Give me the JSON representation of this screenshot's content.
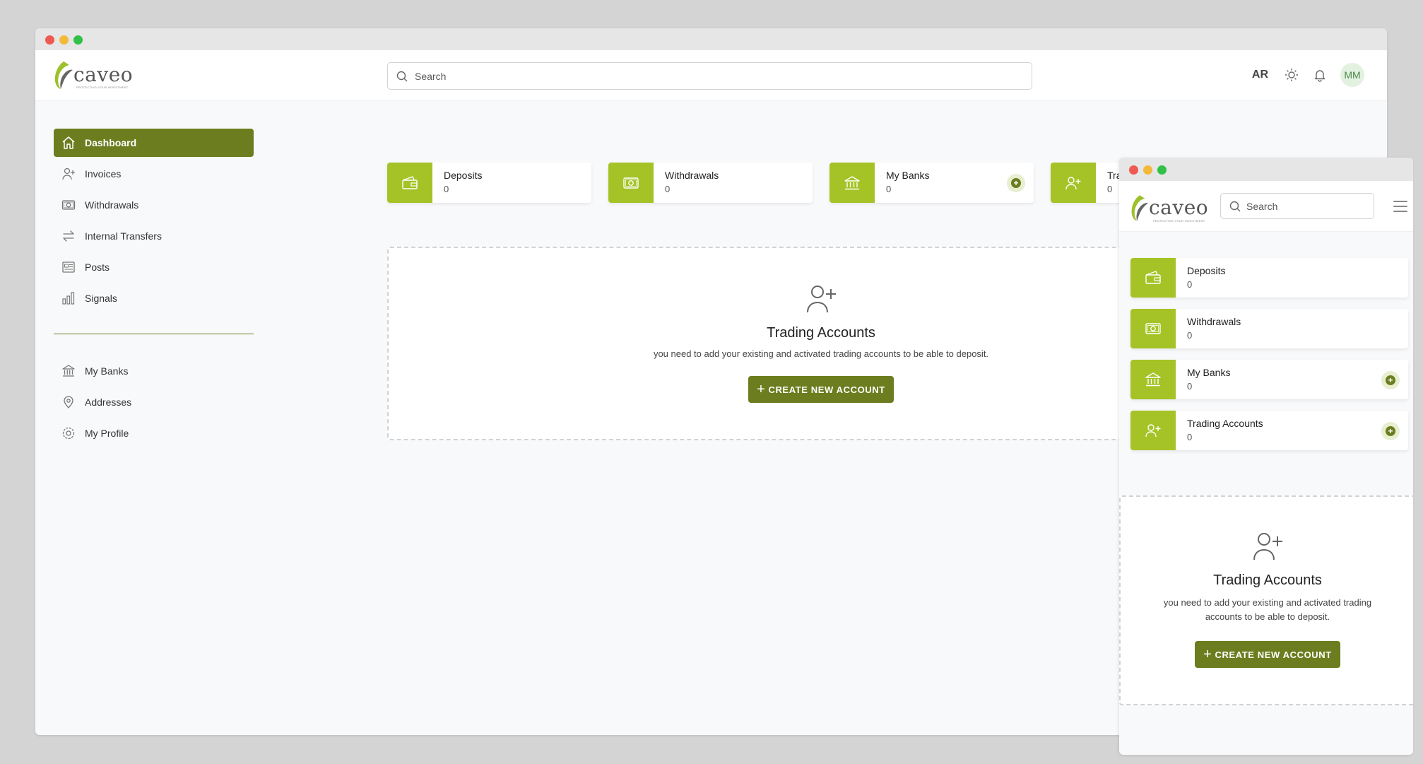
{
  "brand": {
    "name": "caveo",
    "tagline": "PROTECTING YOUR INVESTMENT"
  },
  "colors": {
    "accent": "#6b7d1f",
    "card_icon_bg": "#a5c326",
    "avatar_bg": "#e3f1e1"
  },
  "header": {
    "search_placeholder": "Search",
    "lang": "AR",
    "avatar_initials": "MM",
    "icons": [
      "search-icon",
      "sun-icon",
      "bell-icon"
    ]
  },
  "sidebar": {
    "items": [
      {
        "label": "Dashboard",
        "icon": "home-icon",
        "active": true
      },
      {
        "label": "Invoices",
        "icon": "user-plus-icon"
      },
      {
        "label": "Withdrawals",
        "icon": "money-icon"
      },
      {
        "label": "Internal Transfers",
        "icon": "transfer-icon"
      },
      {
        "label": "Posts",
        "icon": "newspaper-icon"
      },
      {
        "label": "Signals",
        "icon": "bar-chart-icon"
      }
    ],
    "items2": [
      {
        "label": "My Banks",
        "icon": "bank-icon"
      },
      {
        "label": "Addresses",
        "icon": "location-icon"
      },
      {
        "label": "My Profile",
        "icon": "settings-icon"
      }
    ]
  },
  "cards": [
    {
      "title": "Deposits",
      "value": "0",
      "icon": "wallet-icon"
    },
    {
      "title": "Withdrawals",
      "value": "0",
      "icon": "money-icon"
    },
    {
      "title": "My Banks",
      "value": "0",
      "icon": "bank-icon",
      "add": true
    },
    {
      "title": "Tra",
      "value": "0",
      "icon": "user-plus-icon"
    }
  ],
  "mobile_cards": [
    {
      "title": "Deposits",
      "value": "0",
      "icon": "wallet-icon"
    },
    {
      "title": "Withdrawals",
      "value": "0",
      "icon": "money-icon"
    },
    {
      "title": "My Banks",
      "value": "0",
      "icon": "bank-icon",
      "add": true
    },
    {
      "title": "Trading Accounts",
      "value": "0",
      "icon": "user-plus-icon",
      "add": true
    }
  ],
  "empty_state": {
    "icon": "user-plus-icon",
    "title": "Trading Accounts",
    "description": "you need to add your existing and activated trading accounts to be able to deposit.",
    "button_label": "CREATE NEW ACCOUNT"
  }
}
